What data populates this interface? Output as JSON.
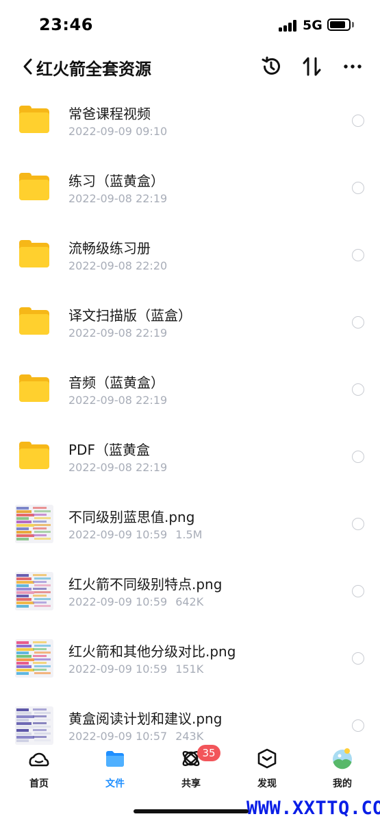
{
  "status_bar": {
    "time": "23:46",
    "network": "5G"
  },
  "header": {
    "title": "红火箭全套资源"
  },
  "icons": {
    "back": "chevron-left-icon",
    "history": "history-icon",
    "sort": "sort-icon",
    "more": "more-icon"
  },
  "files": [
    {
      "name": "常爸课程视频",
      "date": "2022-09-09 09:10",
      "size": "",
      "type": "folder"
    },
    {
      "name": "练习（蓝黄盒）",
      "date": "2022-09-08 22:19",
      "size": "",
      "type": "folder"
    },
    {
      "name": "流畅级练习册",
      "date": "2022-09-08 22:20",
      "size": "",
      "type": "folder"
    },
    {
      "name": "译文扫描版（蓝盒）",
      "date": "2022-09-08 22:19",
      "size": "",
      "type": "folder"
    },
    {
      "name": "音频（蓝黄盒）",
      "date": "2022-09-08 22:19",
      "size": "",
      "type": "folder"
    },
    {
      "name": "PDF（蓝黄盒",
      "date": "2022-09-08 22:19",
      "size": "",
      "type": "folder"
    },
    {
      "name": "不同级别蓝思值.png",
      "date": "2022-09-09 10:59",
      "size": "1.5M",
      "type": "image"
    },
    {
      "name": "红火箭不同级别特点.png",
      "date": "2022-09-09 10:59",
      "size": "642K",
      "type": "image"
    },
    {
      "name": "红火箭和其他分级对比.png",
      "date": "2022-09-09 10:59",
      "size": "151K",
      "type": "image"
    },
    {
      "name": "黄盒阅读计划和建议.png",
      "date": "2022-09-09 10:57",
      "size": "243K",
      "type": "image"
    }
  ],
  "tab_bar": {
    "tabs": [
      {
        "label": "首页",
        "icon": "home-icon"
      },
      {
        "label": "文件",
        "icon": "folder-icon"
      },
      {
        "label": "共享",
        "icon": "share-icon"
      },
      {
        "label": "发现",
        "icon": "discover-icon"
      },
      {
        "label": "我的",
        "icon": "profile-avatar-icon"
      }
    ],
    "active_index": 1,
    "share_badge": "35"
  },
  "watermark": "WWW.XXTTQ.COM",
  "colors": {
    "accent": "#1f8fff",
    "folder": "#ffd02e",
    "badge": "#f2555a",
    "meta_text": "#a8adb8",
    "watermark": "#0a1ee6"
  }
}
